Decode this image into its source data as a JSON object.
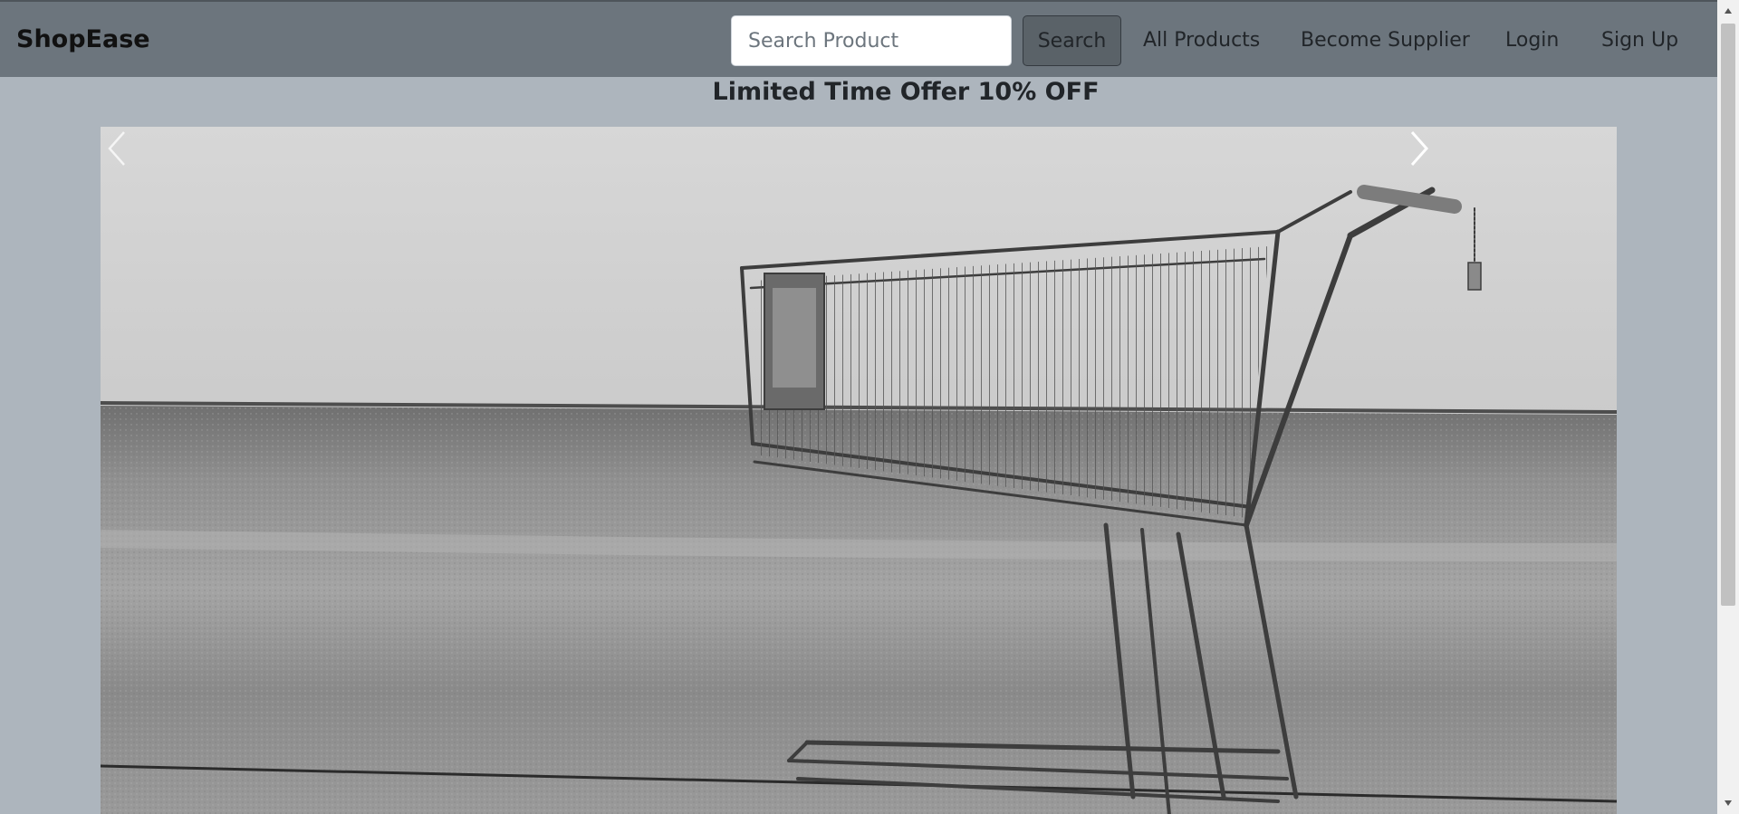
{
  "navbar": {
    "brand": "ShopEase",
    "search_placeholder": "Search Product",
    "search_value": "",
    "search_button": "Search",
    "links": [
      "All Products",
      "Become Supplier",
      "Login",
      "Sign Up"
    ]
  },
  "offer": {
    "title": "Limited Time Offer 10% OFF"
  },
  "carousel": {
    "image_subject": "shopping-cart-photo",
    "prev_icon": "chevron-left-icon",
    "next_icon": "chevron-right-icon"
  },
  "colors": {
    "navbar_bg": "#6c757d",
    "page_bg": "#adb5bd",
    "search_button_bg": "#5a6268",
    "text": "#212529"
  }
}
